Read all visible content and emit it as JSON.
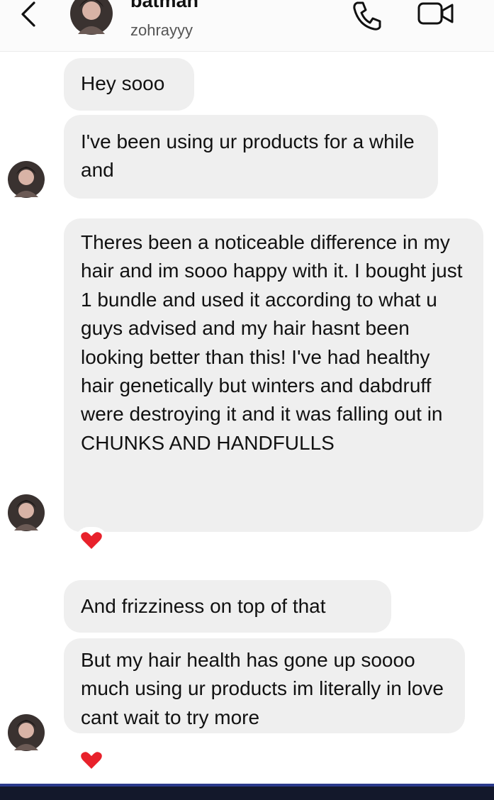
{
  "header": {
    "contact_name": "batman",
    "contact_handle": "zohrayyy"
  },
  "messages": [
    {
      "text": "Hey sooo"
    },
    {
      "text": "I've been using ur products for a while and"
    },
    {
      "text": "Theres been a noticeable difference in my hair and im sooo happy with it. I bought just 1 bundle and used it according to what u guys advised and my hair hasnt been looking better than this! I've had healthy hair genetically but winters and dabdruff were destroying it and it was falling out in CHUNKS AND HANDFULLS",
      "reaction": "heart"
    },
    {
      "text": "And frizziness on top of that"
    },
    {
      "text": "But my hair health has gone up soooo much using ur products im literally in love cant wait to try more",
      "reaction": "heart"
    }
  ],
  "icons": {
    "back": "chevron-left-icon",
    "call": "phone-icon",
    "video": "video-camera-icon",
    "reaction": "heart-icon"
  },
  "colors": {
    "bubble": "#efefef",
    "heart": "#e8212b",
    "bottom_bar": "#13182b"
  }
}
